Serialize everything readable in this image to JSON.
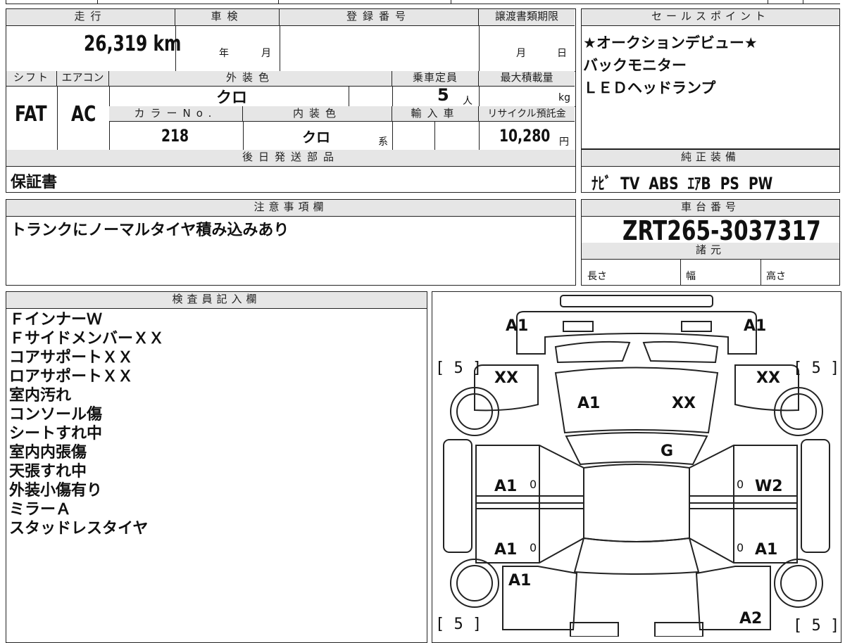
{
  "top": {
    "mileage_label": "走行",
    "mileage": "26,319 km",
    "inspection_label": "車検",
    "year_unit": "年",
    "month_unit": "月",
    "reg_label": "登録番号",
    "transfer_label": "譲渡書類期限",
    "t_month": "月",
    "t_day": "日",
    "shift_label": "シフト",
    "shift": "FAT",
    "ac_label": "エアコン",
    "ac": "AC",
    "ext_color_label": "外装色",
    "ext_color": "クロ",
    "capacity_label": "乗車定員",
    "capacity": "5",
    "person_unit": "人",
    "maxload_label": "最大積載量",
    "kg_unit": "kg",
    "color_no_label": "カラーNo.",
    "color_no": "218",
    "int_color_label": "内装色",
    "int_color": "クロ",
    "kei": "系",
    "import_label": "輸入車",
    "recycle_label": "リサイクル預託金",
    "recycle": "10,280",
    "yen": "円",
    "later_label": "後日発送部品",
    "later": "保証書"
  },
  "sales": {
    "label": "セールスポイント",
    "lines": [
      "★オークションデビュー★",
      "バックモニター",
      "ＬＥＤヘッドランプ"
    ]
  },
  "equipment": {
    "label": "純正装備",
    "value": "ﾅﾋﾞ  TV  ABS  ｴｱB  PS  PW"
  },
  "notes": {
    "label": "注意事項欄",
    "value": "トランクにノーマルタイヤ積み込みあり"
  },
  "chassis": {
    "label": "車台番号",
    "value": "ZRT265-3037317"
  },
  "specs": {
    "label": "諸元",
    "length": "長さ",
    "width": "幅",
    "height": "高さ"
  },
  "inspector": {
    "label": "検査員記入欄",
    "lines": [
      "ＦインナーＷ",
      "ＦサイドメンバーＸＸ",
      "コアサポートＸＸ",
      "ロアサポートＸＸ",
      "室内汚れ",
      "コンソール傷",
      "シートすれ中",
      "室内内張傷",
      "天張すれ中",
      "外装小傷有り",
      "ミラーＡ",
      "スタッドレスタイヤ"
    ]
  },
  "diagram": {
    "a1_fl": "A1",
    "a1_fr": "A1",
    "t_fl": "[ 5 ]",
    "t_fr": "[ 5 ]",
    "t_rl": "[ 5 ]",
    "t_rr": "[ 5 ]",
    "xx_l": "XX",
    "xx_r": "XX",
    "hood_a1": "A1",
    "hood_xx": "XX",
    "glass": "G",
    "fd_l": "A1",
    "fd_l0": "0",
    "fd_r": "W2",
    "fd_r0": "0",
    "rd_l": "A1",
    "rd_l0": "0",
    "rd_r": "A1",
    "rd_r0": "0",
    "rq_l": "A1",
    "rq_r": "A2"
  }
}
